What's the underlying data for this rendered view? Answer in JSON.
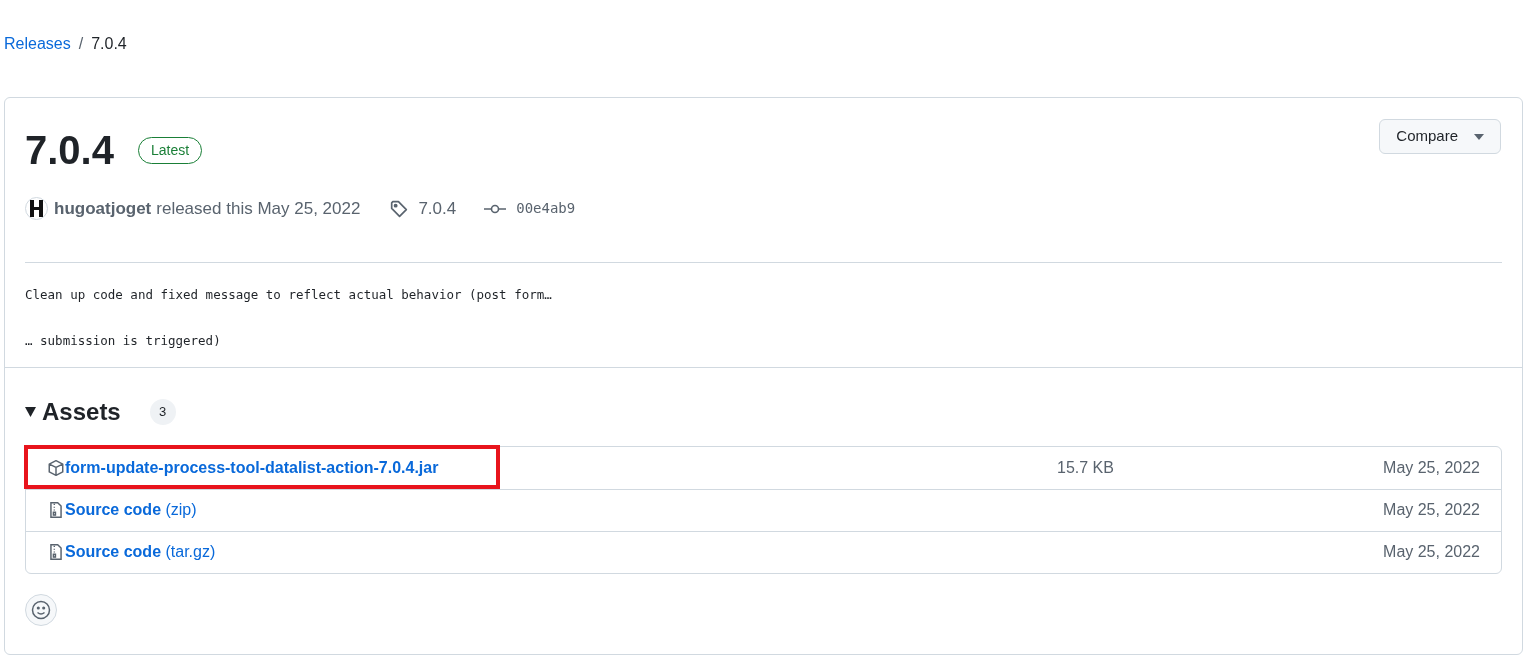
{
  "breadcrumb": {
    "parent": "Releases",
    "separator": "/",
    "current": "7.0.4"
  },
  "release": {
    "title": "7.0.4",
    "badge": "Latest",
    "compare_button": "Compare",
    "author": "hugoatjoget",
    "released_text": "released this May 25, 2022",
    "tag": "7.0.4",
    "commit": "00e4ab9",
    "notes": [
      "Clean up code and fixed message to reflect actual behavior (post form…",
      "… submission is triggered)"
    ]
  },
  "assets": {
    "title": "Assets",
    "expanded": true,
    "count": "3",
    "items": [
      {
        "kind": "package",
        "name": "form-update-process-tool-datalist-action-7.0.4.jar",
        "size": "15.7 KB",
        "date": "May 25, 2022",
        "highlighted": true
      },
      {
        "kind": "archive",
        "name": "Source code",
        "suffix": "(zip)",
        "date": "May 25, 2022",
        "highlighted": false
      },
      {
        "kind": "archive",
        "name": "Source code",
        "suffix": "(tar.gz)",
        "date": "May 25, 2022",
        "highlighted": false
      }
    ]
  }
}
